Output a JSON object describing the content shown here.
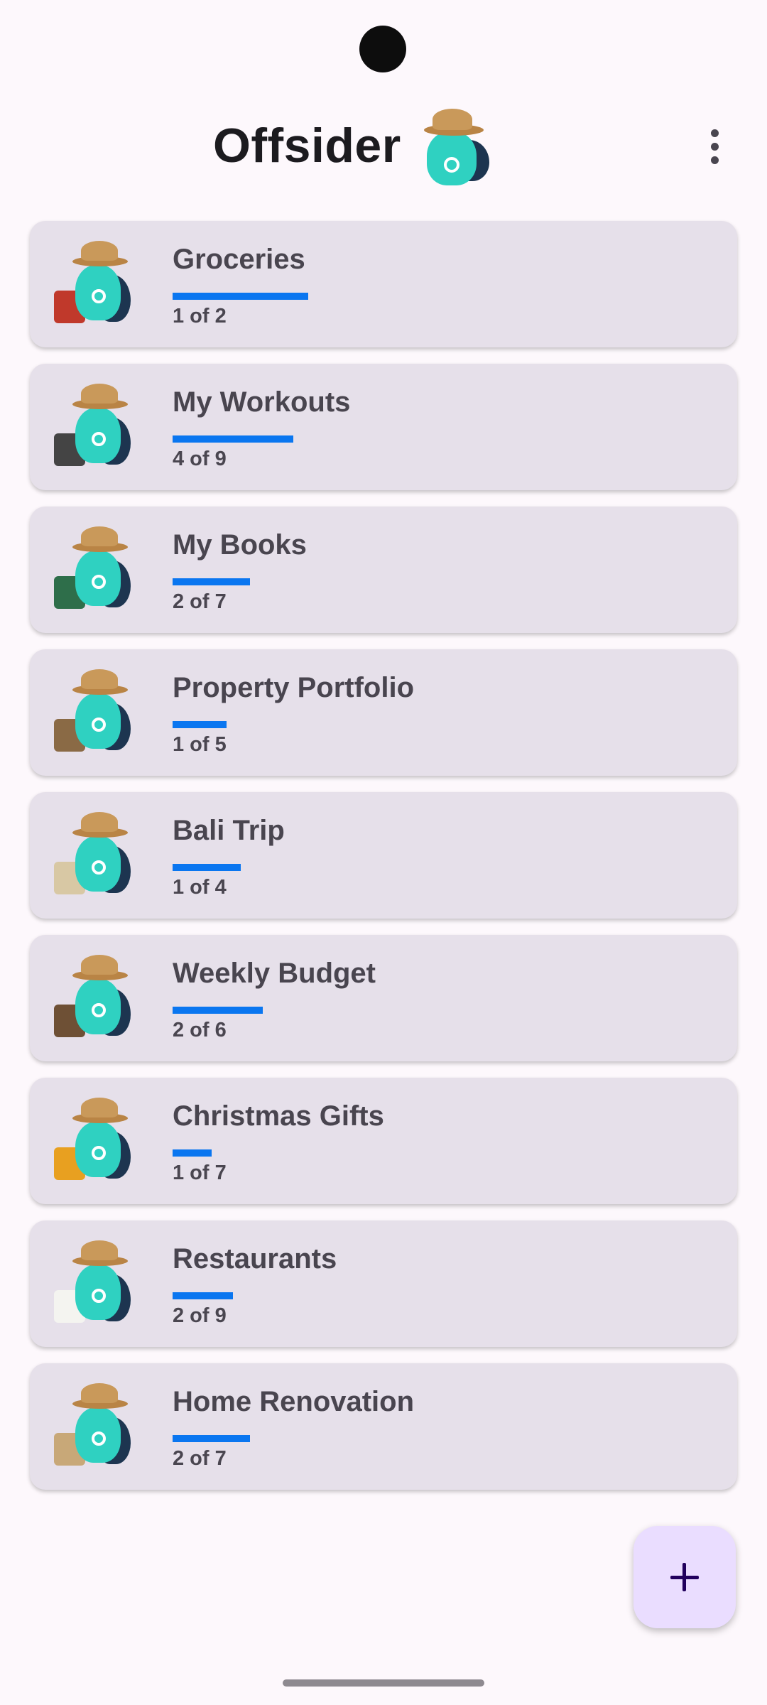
{
  "app": {
    "title": "Offsider",
    "mascot_icon": "offsider-mascot-icon",
    "menu_icon": "more-vert-icon"
  },
  "colors": {
    "background": "#fdf8fc",
    "card": "#e6e0ea",
    "progress": "#0a76f0",
    "fab": "#eaddff",
    "fab_icon": "#21005d"
  },
  "lists": [
    {
      "name": "Groceries",
      "count": "1 of 2",
      "progress": 0.5,
      "icon": "mascot-shopping-cart-icon"
    },
    {
      "name": "My Workouts",
      "count": "4 of 9",
      "progress": 0.444,
      "icon": "mascot-barbell-icon"
    },
    {
      "name": "My Books",
      "count": "2 of 7",
      "progress": 0.286,
      "icon": "mascot-reading-book-icon"
    },
    {
      "name": "Property Portfolio",
      "count": "1 of 5",
      "progress": 0.2,
      "icon": "mascot-houses-icon"
    },
    {
      "name": "Bali Trip",
      "count": "1 of 4",
      "progress": 0.25,
      "icon": "mascot-suitcase-icon"
    },
    {
      "name": "Weekly Budget",
      "count": "2 of 6",
      "progress": 0.333,
      "icon": "mascot-money-table-icon"
    },
    {
      "name": "Christmas Gifts",
      "count": "1 of 7",
      "progress": 0.143,
      "icon": "mascot-gifts-icon"
    },
    {
      "name": "Restaurants",
      "count": "2 of 9",
      "progress": 0.222,
      "icon": "mascot-dining-table-icon"
    },
    {
      "name": "Home Renovation",
      "count": "2 of 7",
      "progress": 0.286,
      "icon": "mascot-painting-house-icon"
    }
  ],
  "fab": {
    "icon": "plus-icon"
  }
}
